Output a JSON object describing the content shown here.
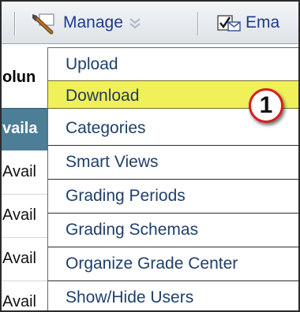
{
  "toolbar": {
    "manage_label": "Manage",
    "email_label": "Ema",
    "manage_icon": "wrench-icon",
    "email_icon": "email-icon",
    "chevron_icon": "chevron-down-icon"
  },
  "background_table": {
    "header_fragment": "olun",
    "availability_header": "vaila",
    "rows": [
      "Avail",
      "Avail",
      "Avail",
      "Avail"
    ]
  },
  "menu": {
    "items": [
      {
        "label": "Upload"
      },
      {
        "label": "Download"
      },
      {
        "label": "Categories"
      },
      {
        "label": "Smart Views"
      },
      {
        "label": "Grading Periods"
      },
      {
        "label": "Grading Schemas"
      },
      {
        "label": "Organize Grade Center"
      },
      {
        "label": "Show/Hide Users"
      }
    ],
    "highlighted_item": "Download",
    "highlight_color": "#f0f05a"
  },
  "annotation": {
    "callout_number": "1",
    "callout_color": "#d61f1f"
  }
}
